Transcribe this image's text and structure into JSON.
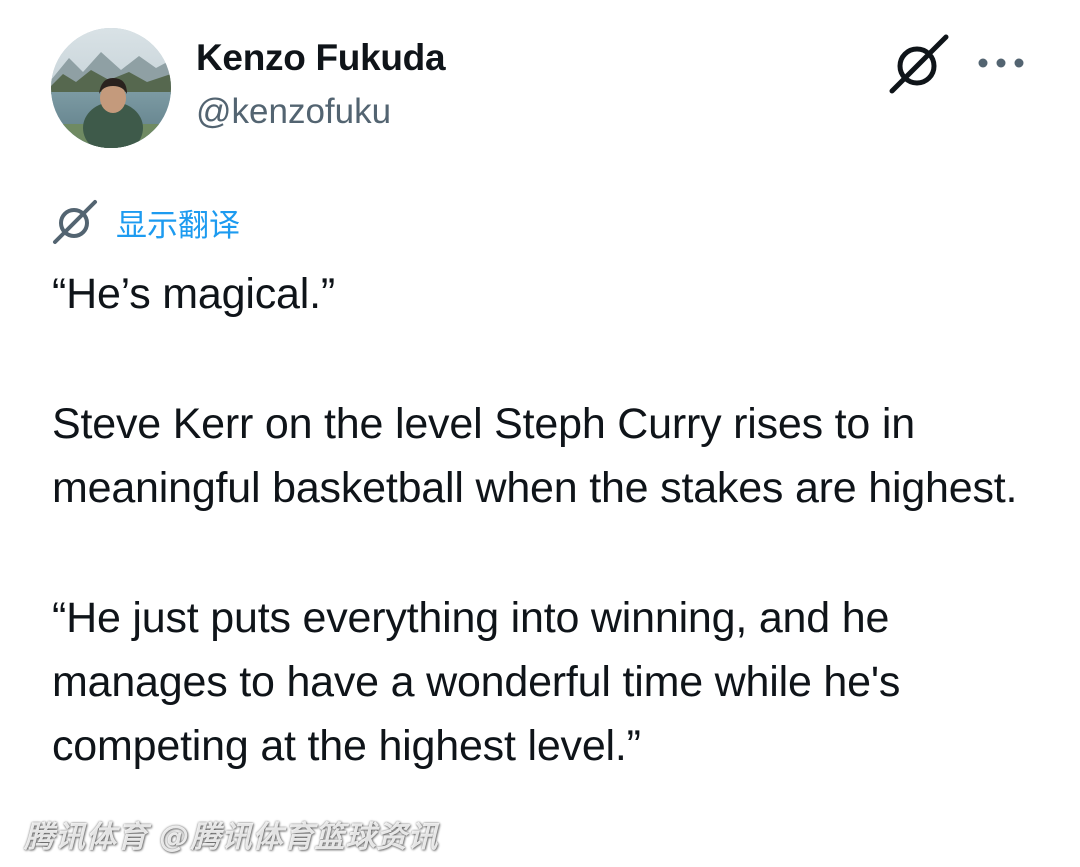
{
  "author": {
    "display_name": "Kenzo Fukuda",
    "handle": "@kenzofuku",
    "avatar_icon": "profile-photo-avatar"
  },
  "header_icons": {
    "grok": "grok-icon",
    "more": "more-options-icon"
  },
  "translate": {
    "label": "显示翻译",
    "icon": "grok-translate-icon",
    "color": "#1d9bf0"
  },
  "tweet": {
    "paragraphs": [
      "“He’s magical.”",
      "Steve Kerr on the level Steph Curry rises to in meaningful basketball when the stakes are highest.",
      "“He just puts everything into winning, and he manages to have a wonderful time while he's competing at the highest level.”"
    ]
  },
  "watermark": {
    "text": "腾讯体育 @腾讯体育篮球资讯"
  },
  "colors": {
    "text_primary": "#0f1419",
    "text_secondary": "#536471",
    "accent": "#1d9bf0",
    "background": "#ffffff"
  }
}
